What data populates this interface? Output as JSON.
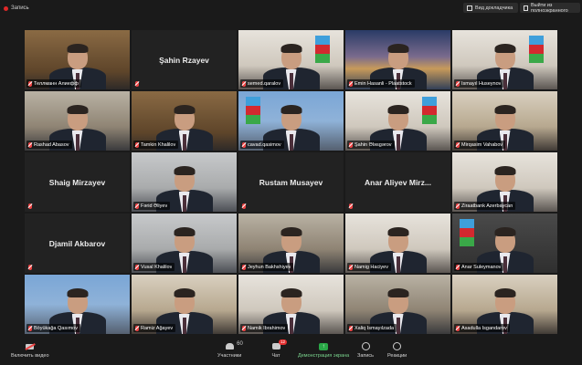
{
  "topbar": {
    "recording_label": "Запись",
    "gallery_label": "Вид докладчика",
    "fullscreen_label": "Выйти из полноэкранного"
  },
  "tiles": [
    {
      "name": "Теллманн Алиефф",
      "video": true,
      "bg": "bg-wood"
    },
    {
      "name": "Şahin Rzayev",
      "video": false
    },
    {
      "name": "semed.qaralov",
      "video": true,
      "bg": "bg-light",
      "flag": true
    },
    {
      "name": "Emin Hasanli - Plaatstock",
      "video": true,
      "bg": "bg-city"
    },
    {
      "name": "İsmayıl Huseynov",
      "video": true,
      "bg": "bg-light",
      "flag": true,
      "active": true
    },
    {
      "name": "Rashad Abasov",
      "video": true,
      "bg": "bg-office"
    },
    {
      "name": "Tamkin Khalilov",
      "video": true,
      "bg": "bg-wood"
    },
    {
      "name": "cavad.qasimov",
      "video": true,
      "bg": "bg-blue",
      "flag": true
    },
    {
      "name": "Şahin Ələsgərov",
      "video": true,
      "bg": "bg-light",
      "flag": true
    },
    {
      "name": "Mirqasim Vahabov",
      "video": true,
      "bg": "bg-room"
    },
    {
      "name": "Shaig Mirzayev",
      "video": false
    },
    {
      "name": "Fərid Əliyev",
      "video": true,
      "bg": "bg-grey"
    },
    {
      "name": "Rustam Musayev",
      "video": false
    },
    {
      "name": "Anar Aliyev Mirz...",
      "video": false
    },
    {
      "name": "Ziraatbank Azerbaycan",
      "video": true,
      "bg": "bg-light"
    },
    {
      "name": "Djamil Akbarov",
      "video": false
    },
    {
      "name": "Vusal Khalilov",
      "video": true,
      "bg": "bg-grey"
    },
    {
      "name": "Jeyhun Bakhshiyev",
      "video": true,
      "bg": "bg-office"
    },
    {
      "name": "Namig Haciyev",
      "video": true,
      "bg": "bg-light"
    },
    {
      "name": "Anar Suleymanov",
      "video": true,
      "bg": "bg-dark",
      "flag": true
    },
    {
      "name": "Böyükağa Qasımov",
      "video": true,
      "bg": "bg-blue"
    },
    {
      "name": "Ramiz Ağayev",
      "video": true,
      "bg": "bg-room"
    },
    {
      "name": "Namik İbrahimov",
      "video": true,
      "bg": "bg-light"
    },
    {
      "name": "Xaliq İsmayılzada",
      "video": true,
      "bg": "bg-office"
    },
    {
      "name": "Asadulla Isgandarov",
      "video": true,
      "bg": "bg-room"
    }
  ],
  "toolbar": {
    "video_label": "Включить видео",
    "participants_label": "Участники",
    "participants_count": "60",
    "chat_label": "Чат",
    "chat_badge": "12",
    "share_label": "Демонстрация экрана",
    "record_label": "Запись",
    "reactions_label": "Реакции"
  },
  "colors": {
    "active_speaker_border": "#e8d23a",
    "share_green": "#29a847",
    "mic_muted": "#e44444"
  }
}
